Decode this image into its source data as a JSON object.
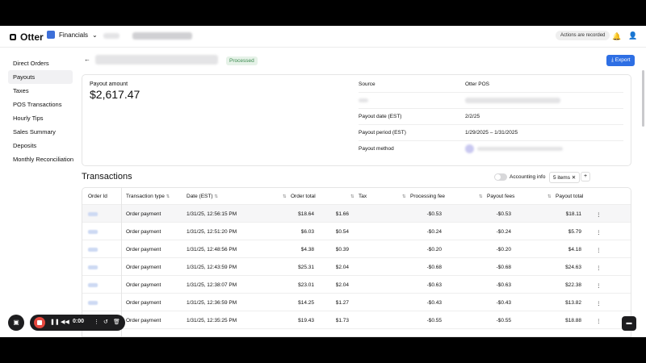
{
  "header": {
    "app_name": "Otter",
    "business_selector": "Financials",
    "recorded_badge": "Actions are recorded",
    "bell_icon": "bell-icon",
    "user_icon": "user-icon"
  },
  "sidebar": {
    "items": [
      {
        "label": "Direct Orders"
      },
      {
        "label": "Payouts",
        "active": true
      },
      {
        "label": "Taxes"
      },
      {
        "label": "POS Transactions"
      },
      {
        "label": "Hourly Tips"
      },
      {
        "label": "Sales Summary"
      },
      {
        "label": "Deposits"
      },
      {
        "label": "Monthly Reconciliation"
      }
    ]
  },
  "payout": {
    "status": "Processed",
    "export_label": "Export",
    "amount_label": "Payout amount",
    "amount": "$2,617.47",
    "details": [
      {
        "key": "Source",
        "value": "Otter POS"
      },
      {
        "key": "",
        "value": ""
      },
      {
        "key": "Payout date (EST)",
        "value": "2/2/25"
      },
      {
        "key": "Payout period (EST)",
        "value": "1/29/2025 – 1/31/2025"
      },
      {
        "key": "Payout method",
        "value": ""
      }
    ]
  },
  "transactions": {
    "title": "Transactions",
    "accounting_info_label": "Accounting info",
    "items_filter": "5 items",
    "add_icon": "plus-icon",
    "columns": [
      "Order Id",
      "Transaction type",
      "Date (EST)",
      "Order total",
      "Tax",
      "Processing fee",
      "Payout fees",
      "Payout total"
    ],
    "rows": [
      {
        "type": "Order payment",
        "date": "1/31/25, 12:56:15 PM",
        "order_total": "$18.64",
        "tax": "$1.66",
        "processing_fee": "-$0.53",
        "payout_fees": "-$0.53",
        "payout_total": "$18.11"
      },
      {
        "type": "Order payment",
        "date": "1/31/25, 12:51:20 PM",
        "order_total": "$6.03",
        "tax": "$0.54",
        "processing_fee": "-$0.24",
        "payout_fees": "-$0.24",
        "payout_total": "$5.79"
      },
      {
        "type": "Order payment",
        "date": "1/31/25, 12:48:56 PM",
        "order_total": "$4.38",
        "tax": "$0.39",
        "processing_fee": "-$0.20",
        "payout_fees": "-$0.20",
        "payout_total": "$4.18"
      },
      {
        "type": "Order payment",
        "date": "1/31/25, 12:43:59 PM",
        "order_total": "$25.31",
        "tax": "$2.04",
        "processing_fee": "-$0.68",
        "payout_fees": "-$0.68",
        "payout_total": "$24.63"
      },
      {
        "type": "Order payment",
        "date": "1/31/25, 12:38:07 PM",
        "order_total": "$23.01",
        "tax": "$2.04",
        "processing_fee": "-$0.63",
        "payout_fees": "-$0.63",
        "payout_total": "$22.38"
      },
      {
        "type": "Order payment",
        "date": "1/31/25, 12:36:59 PM",
        "order_total": "$14.25",
        "tax": "$1.27",
        "processing_fee": "-$0.43",
        "payout_fees": "-$0.43",
        "payout_total": "$13.82"
      },
      {
        "type": "Order payment",
        "date": "1/31/25, 12:35:25 PM",
        "order_total": "$19.43",
        "tax": "$1.73",
        "processing_fee": "-$0.55",
        "payout_fees": "-$0.55",
        "payout_total": "$18.88"
      }
    ]
  },
  "recorder": {
    "timer": "0:00",
    "camera_icon": "camera-icon",
    "stop_icon": "stop-icon",
    "pause_icon": "pause-icon",
    "rewind_icon": "rewind-icon",
    "undo_icon": "undo-icon",
    "trash_icon": "trash-icon",
    "chat_icon": "chat-icon"
  },
  "colors": {
    "accent": "#2e6fe4",
    "processed": "#3a8a4e",
    "record": "#e4473e"
  }
}
